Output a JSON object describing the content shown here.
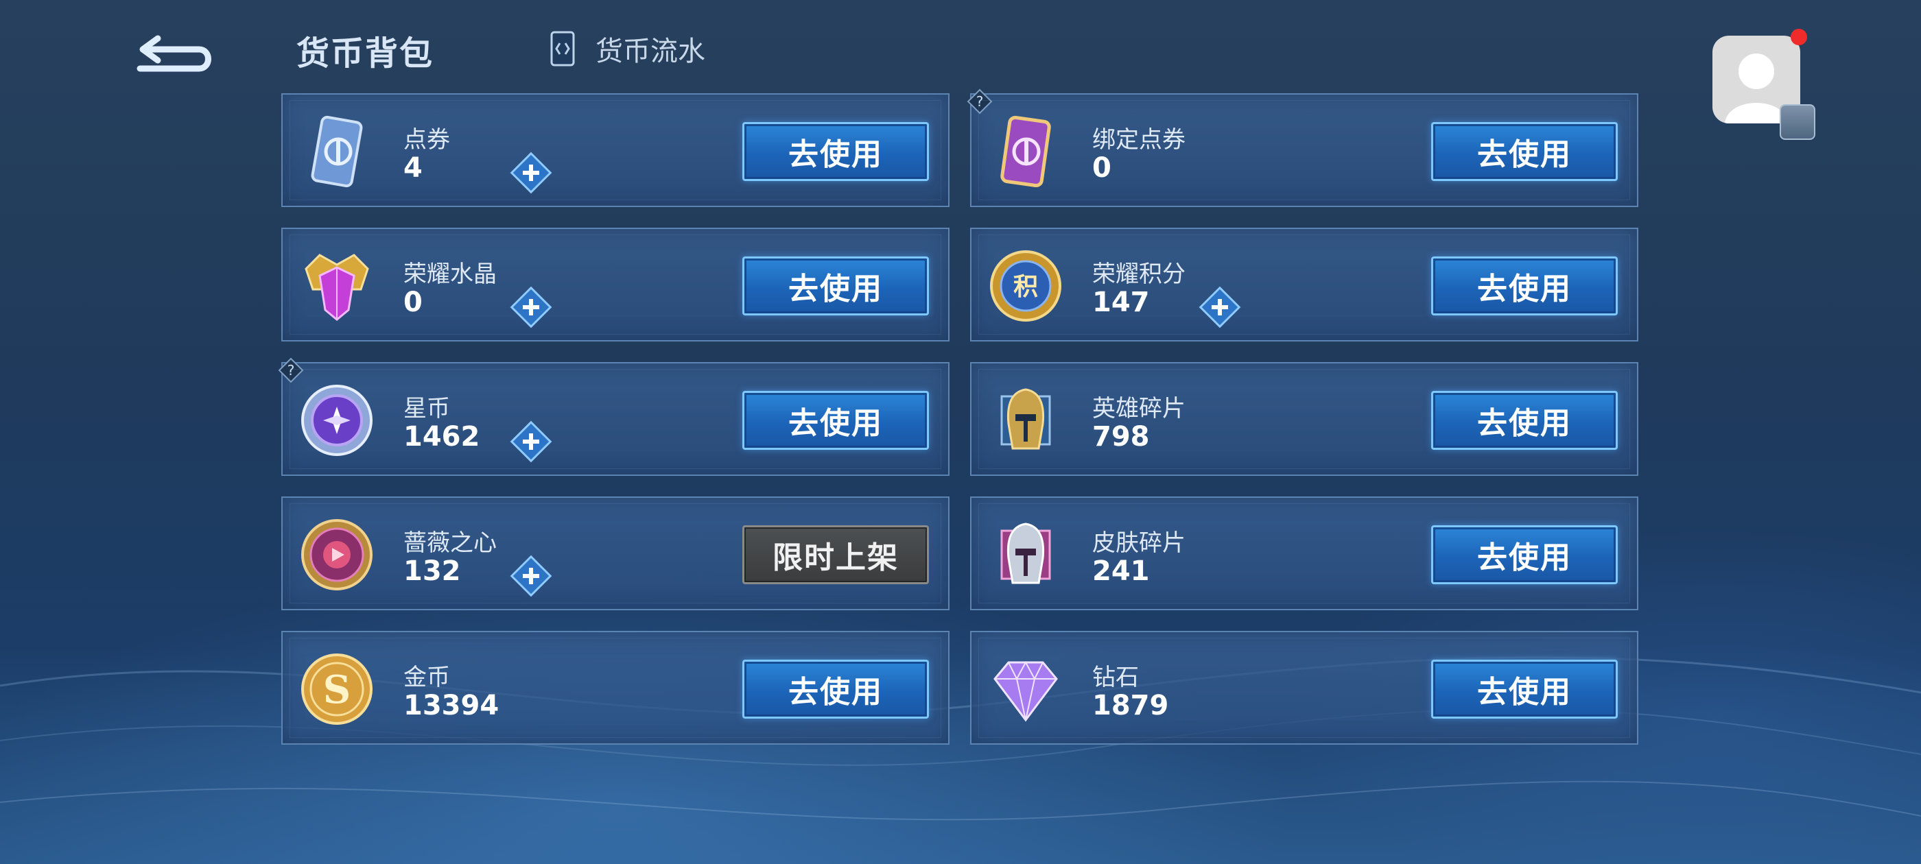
{
  "header": {
    "title": "货币背包",
    "flow_label": "货币流水"
  },
  "currencies": [
    {
      "name": "点券",
      "value": "4",
      "button": "去使用",
      "has_plus": true,
      "icon": "coupon-ticket-icon"
    },
    {
      "name": "绑定点券",
      "value": "0",
      "button": "去使用",
      "has_plus": false,
      "has_help": true,
      "icon": "bound-coupon-icon"
    },
    {
      "name": "荣耀水晶",
      "value": "0",
      "button": "去使用",
      "has_plus": true,
      "icon": "glory-crystal-icon"
    },
    {
      "name": "荣耀积分",
      "value": "147",
      "button": "去使用",
      "has_plus": true,
      "icon": "glory-points-icon"
    },
    {
      "name": "星币",
      "value": "1462",
      "button": "去使用",
      "has_plus": true,
      "has_help": true,
      "icon": "star-coin-icon"
    },
    {
      "name": "英雄碎片",
      "value": "798",
      "button": "去使用",
      "has_plus": false,
      "icon": "hero-fragment-icon"
    },
    {
      "name": "蔷薇之心",
      "value": "132",
      "button": "限时上架",
      "has_plus": true,
      "icon": "rose-heart-icon"
    },
    {
      "name": "皮肤碎片",
      "value": "241",
      "button": "去使用",
      "has_plus": false,
      "icon": "skin-fragment-icon"
    },
    {
      "name": "金币",
      "value": "13394",
      "button": "去使用",
      "has_plus": false,
      "icon": "gold-coin-icon"
    },
    {
      "name": "钻石",
      "value": "1879",
      "button": "去使用",
      "has_plus": false,
      "icon": "diamond-icon"
    }
  ],
  "colors": {
    "accent": "#2c86d8",
    "button_border": "#7cc8ff",
    "disabled_button": "#4d5052",
    "notification_dot": "#ef2b2b"
  }
}
